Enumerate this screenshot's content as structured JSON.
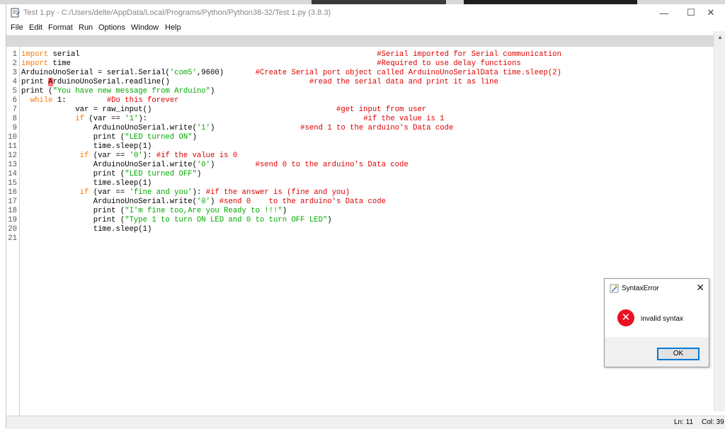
{
  "window": {
    "title": "Test 1.py - C:/Users/delte/AppData/Local/Programs/Python/Python38-32/Test 1.py (3.8.3)",
    "controls": {
      "minimize": "—",
      "maximize": "☐",
      "close": "✕"
    }
  },
  "menu": [
    "File",
    "Edit",
    "Format",
    "Run",
    "Options",
    "Window",
    "Help"
  ],
  "editor": {
    "line_numbers": [
      "1",
      "2",
      "3",
      "4",
      "5",
      "6",
      "7",
      "8",
      "9",
      "10",
      "11",
      "12",
      "13",
      "14",
      "15",
      "16",
      "17",
      "18",
      "19",
      "20",
      "21"
    ],
    "lines": [
      [
        {
          "t": "import",
          "c": "kw"
        },
        {
          "t": " serial                                                                  "
        },
        {
          "t": "#Serial imported for Serial communication",
          "c": "cm"
        }
      ],
      [
        {
          "t": "import",
          "c": "kw"
        },
        {
          "t": " time                                                                    "
        },
        {
          "t": "#Required to use delay functions",
          "c": "cm"
        }
      ],
      [
        {
          "t": "ArduinoUnoSerial = serial.Serial("
        },
        {
          "t": "'com5'",
          "c": "str"
        },
        {
          "t": ",9600)       "
        },
        {
          "t": "#Create Serial port object called ArduinoUnoSerialData time.sleep(2)",
          "c": "cm"
        }
      ],
      [
        {
          "t": "print "
        },
        {
          "t": "A",
          "c": "err"
        },
        {
          "t": "rduinoUnoSerial.readline()                               "
        },
        {
          "t": "#read the serial data and print it as line",
          "c": "cm"
        }
      ],
      [
        {
          "t": "print ("
        },
        {
          "t": "\"You have new message from Arduino\"",
          "c": "str"
        },
        {
          "t": ")"
        }
      ],
      [
        {
          "t": "  "
        },
        {
          "t": "while",
          "c": "kw"
        },
        {
          "t": " 1:         "
        },
        {
          "t": "#Do this forever",
          "c": "cm"
        }
      ],
      [
        {
          "t": "            var = raw_input()                                         "
        },
        {
          "t": "#get input from user",
          "c": "cm"
        }
      ],
      [
        {
          "t": "            "
        },
        {
          "t": "if",
          "c": "kw"
        },
        {
          "t": " (var == "
        },
        {
          "t": "'1'",
          "c": "str"
        },
        {
          "t": "):                                                "
        },
        {
          "t": "#if the value is 1",
          "c": "cm"
        }
      ],
      [
        {
          "t": "                ArduinoUnoSerial.write("
        },
        {
          "t": "'1'",
          "c": "str"
        },
        {
          "t": ")                   "
        },
        {
          "t": "#send 1 to the arduino's Data code",
          "c": "cm"
        }
      ],
      [
        {
          "t": "                print ("
        },
        {
          "t": "\"LED turned ON\"",
          "c": "str"
        },
        {
          "t": ")"
        }
      ],
      [
        {
          "t": "                time.sleep(1)"
        }
      ],
      [
        {
          "t": "             "
        },
        {
          "t": "if",
          "c": "kw"
        },
        {
          "t": " (var == "
        },
        {
          "t": "'0'",
          "c": "str"
        },
        {
          "t": "): "
        },
        {
          "t": "#if the value is 0",
          "c": "cm"
        }
      ],
      [
        {
          "t": "                ArduinoUnoSerial.write("
        },
        {
          "t": "'0'",
          "c": "str"
        },
        {
          "t": ")         "
        },
        {
          "t": "#send 0 to the arduino's Data code",
          "c": "cm"
        }
      ],
      [
        {
          "t": "                print ("
        },
        {
          "t": "\"LED turned OFF\"",
          "c": "str"
        },
        {
          "t": ")"
        }
      ],
      [
        {
          "t": "                time.sleep(1)"
        }
      ],
      [
        {
          "t": "             "
        },
        {
          "t": "if",
          "c": "kw"
        },
        {
          "t": " (var == "
        },
        {
          "t": "'fine and you'",
          "c": "str"
        },
        {
          "t": "): "
        },
        {
          "t": "#if the answer is (fine and you)",
          "c": "cm"
        }
      ],
      [
        {
          "t": "                ArduinoUnoSerial.write("
        },
        {
          "t": "'0'",
          "c": "str"
        },
        {
          "t": ") "
        },
        {
          "t": "#send 0    to the arduino's Data code",
          "c": "cm"
        }
      ],
      [
        {
          "t": "                print ("
        },
        {
          "t": "\"I'm fine too,Are you Ready to !!!\"",
          "c": "str"
        },
        {
          "t": ")"
        }
      ],
      [
        {
          "t": "                print ("
        },
        {
          "t": "\"Type 1 to turn ON LED and 0 to turn OFF LED\"",
          "c": "str"
        },
        {
          "t": ")"
        }
      ],
      [
        {
          "t": "                time.sleep(1)"
        }
      ],
      []
    ]
  },
  "status": {
    "line": "Ln: 11",
    "col": "Col: 39"
  },
  "dialog": {
    "title": "SyntaxError",
    "close": "✕",
    "icon": "error-icon",
    "icon_glyph": "✕",
    "message": "invalid syntax",
    "ok_label": "OK"
  }
}
